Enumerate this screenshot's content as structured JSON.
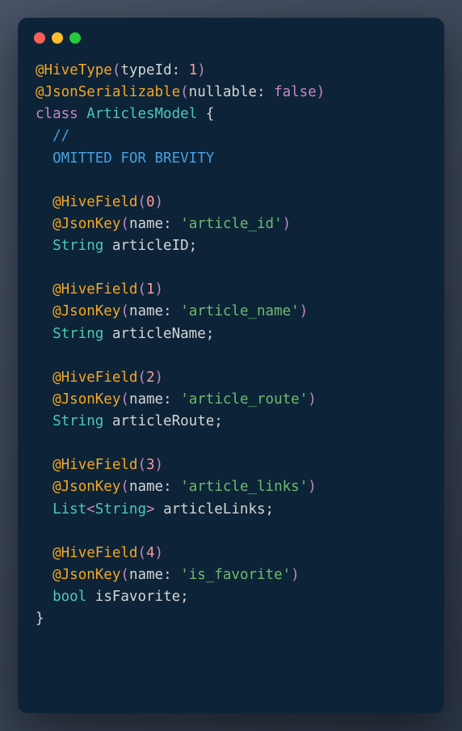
{
  "window": {
    "traffic_lights": [
      "red",
      "yellow",
      "green"
    ]
  },
  "code": {
    "annotations": {
      "hivetype": "HiveType",
      "jsonserializable": "JsonSerializable",
      "hivefield": "HiveField",
      "jsonkey": "JsonKey"
    },
    "params": {
      "typeid": "typeId",
      "nullable": "nullable",
      "name": "name"
    },
    "values": {
      "typeid_val": "1",
      "nullable_val": "false",
      "field0": "0",
      "field1": "1",
      "field2": "2",
      "field3": "3",
      "field4": "4",
      "article_id": "'article_id'",
      "article_name": "'article_name'",
      "article_route": "'article_route'",
      "article_links": "'article_links'",
      "is_favorite": "'is_favorite'"
    },
    "keywords": {
      "class": "class"
    },
    "classname": "ArticlesModel",
    "comment_slash": "//",
    "comment_text": "OMITTED FOR BREVITY",
    "types": {
      "string": "String",
      "list": "List",
      "bool": "bool"
    },
    "fields": {
      "articleID": "articleID",
      "articleName": "articleName",
      "articleRoute": "articleRoute",
      "articleLinks": "articleLinks",
      "isFavorite": "isFavorite"
    },
    "punct": {
      "at": "@",
      "lparen": "(",
      "rparen": ")",
      "lbrace": "{",
      "rbrace": "}",
      "lt": "<",
      "gt": ">",
      "colon": ":",
      "semi": ";",
      "space": " "
    }
  }
}
